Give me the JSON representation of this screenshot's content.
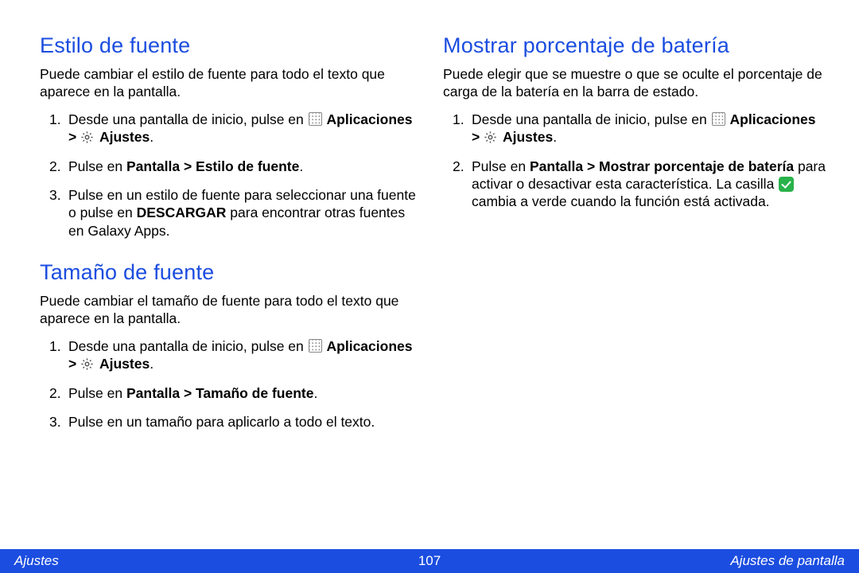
{
  "left": {
    "sec1": {
      "heading": "Estilo de fuente",
      "intro": "Puede cambiar el estilo de fuente para todo el texto que aparece en la pantalla.",
      "step1_a": "Desde una pantalla de inicio, pulse en ",
      "apps_label": "Aplicaciones",
      "gt": " > ",
      "settings_label": "Ajustes",
      "period": ".",
      "step2_a": "Pulse en ",
      "step2_b": "Pantalla > Estilo de fuente",
      "step3_a": "Pulse en un estilo de fuente para seleccionar una fuente o pulse en ",
      "step3_b": "DESCARGAR",
      "step3_c": " para encontrar otras fuentes en Galaxy Apps."
    },
    "sec2": {
      "heading": "Tamaño de fuente",
      "intro": "Puede cambiar el tamaño de fuente para todo el texto que aparece en la pantalla.",
      "step1_a": "Desde una pantalla de inicio, pulse en ",
      "step2_a": "Pulse en ",
      "step2_b": "Pantalla > Tamaño de fuente",
      "step3": "Pulse en un tamaño para aplicarlo a todo el texto."
    }
  },
  "right": {
    "sec1": {
      "heading": "Mostrar porcentaje de batería",
      "intro": "Puede elegir que se muestre o que se oculte el porcentaje de carga de la batería en la barra de estado.",
      "step1_a": "Desde una pantalla de inicio, pulse en ",
      "step2_a": "Pulse en ",
      "step2_b": "Pantalla > Mostrar porcentaje de batería",
      "step2_c": " para activar o desactivar esta característica. La casilla ",
      "step2_d": " cambia a verde cuando la función está activada."
    }
  },
  "icons": {
    "apps": "apps-grid-icon",
    "gear": "settings-gear-icon",
    "check": "checkbox-icon"
  },
  "footer": {
    "left": "Ajustes",
    "center": "107",
    "right": "Ajustes de pantalla"
  },
  "nums": {
    "n1": "1.",
    "n2": "2.",
    "n3": "3."
  }
}
